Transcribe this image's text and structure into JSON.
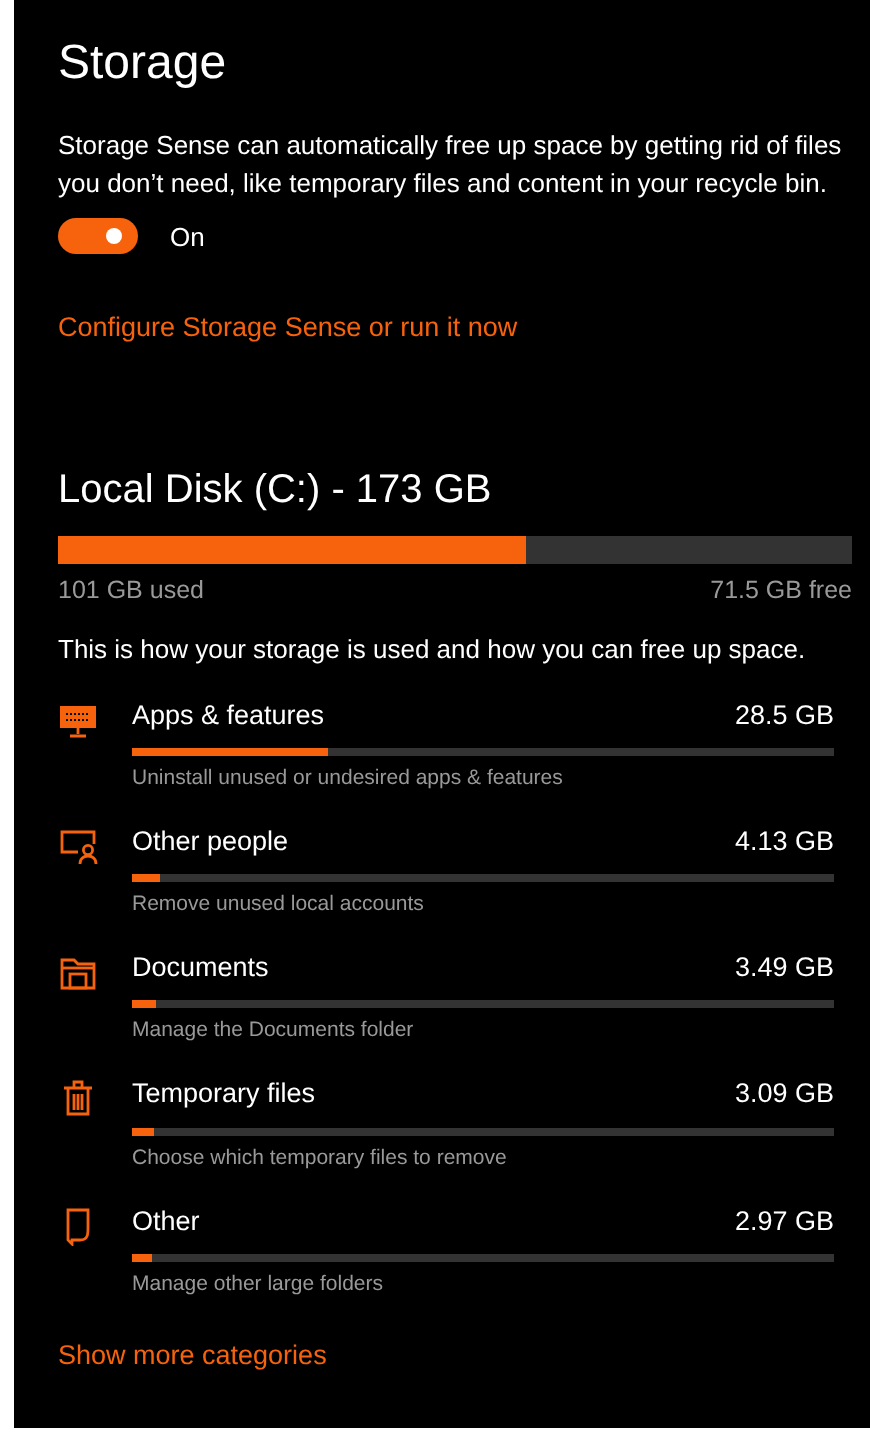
{
  "title": "Storage",
  "description": "Storage Sense can automatically free up space by getting rid of files you don’t need, like temporary files and content in your recycle bin.",
  "toggle": {
    "on": true,
    "label": "On"
  },
  "configure_link": "Configure Storage Sense or run it now",
  "disk": {
    "title": "Local Disk (C:) - 173 GB",
    "level": 0.59,
    "used": "101 GB used",
    "free": "71.5 GB free"
  },
  "intro": "This is how your storage is used and how you can free up space.",
  "categories": [
    {
      "name": "Apps & features",
      "size": "28.5 GB",
      "level": 0.28,
      "hint": "Uninstall unused or undesired apps & features"
    },
    {
      "name": "Other people",
      "size": "4.13 GB",
      "level": 0.04,
      "hint": "Remove unused local accounts"
    },
    {
      "name": "Documents",
      "size": "3.49 GB",
      "level": 0.034,
      "hint": "Manage the Documents folder"
    },
    {
      "name": "Temporary files",
      "size": "3.09 GB",
      "level": 0.03,
      "hint": "Choose which temporary files to remove"
    },
    {
      "name": "Other",
      "size": "2.97 GB",
      "level": 0.028,
      "hint": "Manage other large folders"
    }
  ],
  "more_link": "Show more categories"
}
